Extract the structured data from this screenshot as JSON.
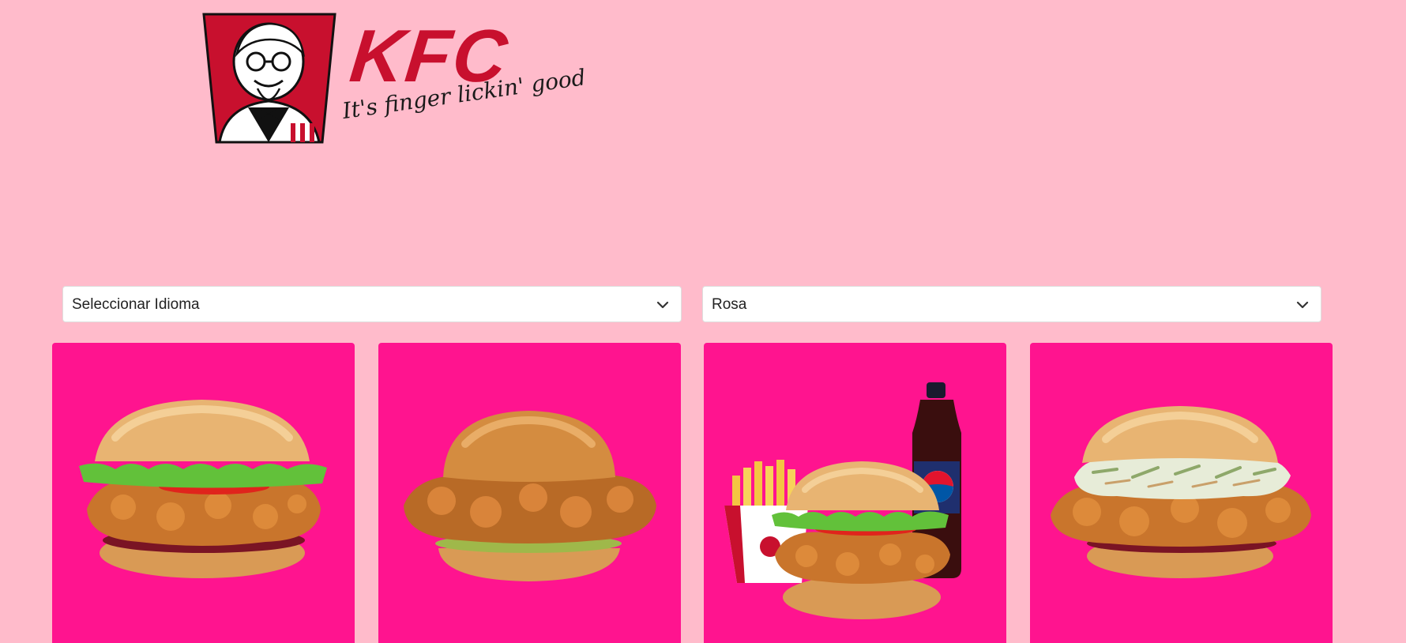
{
  "theme": {
    "page_bg": "#ffbbcb",
    "card_bg": "#ff148f",
    "brand_red": "#c8102e"
  },
  "header": {
    "logo": {
      "wordmark": "KFC",
      "tagline": "It's finger lickin' good"
    }
  },
  "controls": {
    "language_select": {
      "selected": "Seleccionar Idioma",
      "icon": "chevron-down-icon"
    },
    "color_select": {
      "selected": "Rosa",
      "icon": "chevron-down-icon"
    }
  },
  "products": [
    {
      "image": "chicken-burger-lettuce-tomato"
    },
    {
      "image": "chicken-burger-pickles"
    },
    {
      "image": "combo-burger-fries-pepsi"
    },
    {
      "image": "chicken-burger-coleslaw"
    }
  ]
}
